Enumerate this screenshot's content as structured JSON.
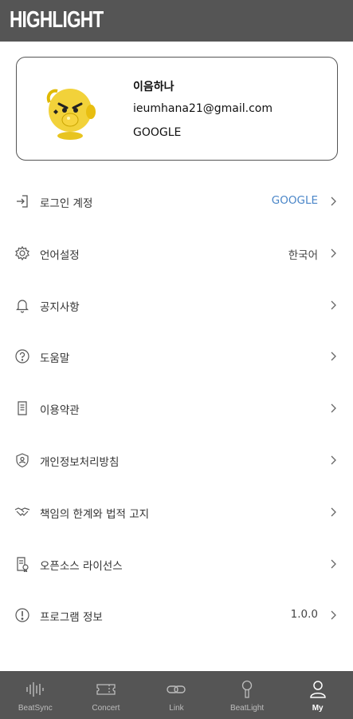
{
  "app": {
    "title": "HIGHLIGHT"
  },
  "profile": {
    "name": "이음하나",
    "email": "ieumhana21@gmail.com",
    "provider": "GOOGLE"
  },
  "menu": [
    {
      "icon": "login-icon",
      "label": "로그인 계정",
      "value": "GOOGLE",
      "value_color": "#4a86c8"
    },
    {
      "icon": "gear-icon",
      "label": "언어설정",
      "value": "한국어"
    },
    {
      "icon": "bell-icon",
      "label": "공지사항",
      "value": ""
    },
    {
      "icon": "help-icon",
      "label": "도움말",
      "value": ""
    },
    {
      "icon": "document-icon",
      "label": "이용약관",
      "value": ""
    },
    {
      "icon": "shield-user-icon",
      "label": "개인정보처리방침",
      "value": ""
    },
    {
      "icon": "handshake-icon",
      "label": "책임의 한계와 법적 고지",
      "value": ""
    },
    {
      "icon": "license-icon",
      "label": "오픈소스 라이선스",
      "value": ""
    },
    {
      "icon": "info-icon",
      "label": "프로그램 정보",
      "value": "1.0.0"
    }
  ],
  "tabs": [
    {
      "icon": "waveform-icon",
      "label": "BeatSync",
      "active": false
    },
    {
      "icon": "ticket-icon",
      "label": "Concert",
      "active": false
    },
    {
      "icon": "link-icon",
      "label": "Link",
      "active": false
    },
    {
      "icon": "lightstick-icon",
      "label": "BeatLight",
      "active": false
    },
    {
      "icon": "person-icon",
      "label": "My",
      "active": true
    }
  ],
  "colors": {
    "header": "#555555",
    "accent": "#4a86c8",
    "avatar": "#f2d23a"
  }
}
